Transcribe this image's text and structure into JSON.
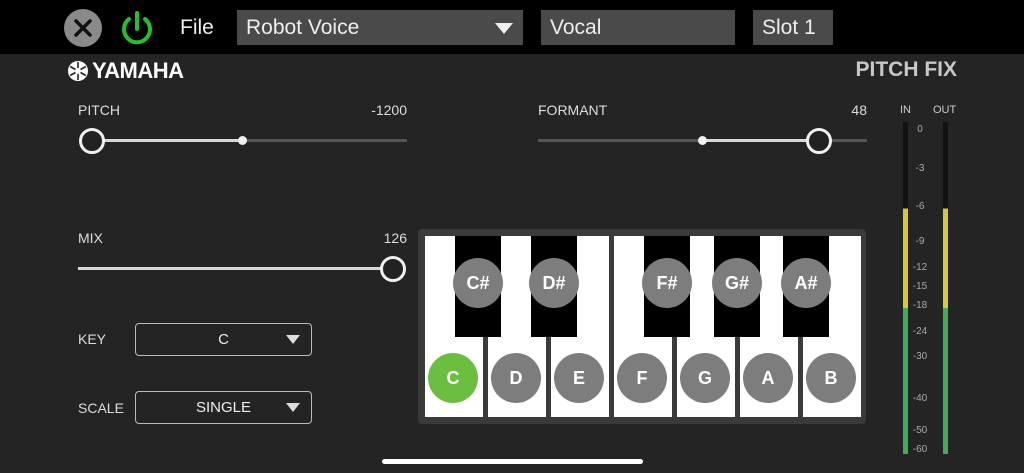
{
  "topbar": {
    "file_label": "File",
    "preset": "Robot Voice",
    "type": "Vocal",
    "slot": "Slot 1",
    "power_color": "#22c22c"
  },
  "brand": {
    "name": "YAMAHA"
  },
  "title": "PITCH FIX",
  "pitch": {
    "label": "PITCH",
    "value": "-1200",
    "level": 0.0
  },
  "formant": {
    "label": "FORMANT",
    "value": "48",
    "level": 0.87
  },
  "mix": {
    "label": "MIX",
    "value": "126",
    "level": 1.0
  },
  "key": {
    "label": "KEY",
    "selected": "C"
  },
  "scale": {
    "label": "SCALE",
    "selected": "SINGLE"
  },
  "keyboard": {
    "white_notes": [
      "C",
      "D",
      "E",
      "F",
      "G",
      "A",
      "B"
    ],
    "black_notes": [
      "C#",
      "D#",
      "F#",
      "G#",
      "A#"
    ],
    "active_note": "C",
    "active_color": "#6abf3f"
  },
  "meters": {
    "in_label": "IN",
    "out_label": "OUT",
    "scale": [
      "0",
      "-3",
      "-6",
      "-9",
      "-12",
      "-15",
      "-18",
      "-24",
      "-30",
      "-40",
      "-50",
      "-60"
    ],
    "colors": {
      "low": "#3fae5a",
      "mid": "#d8c832",
      "dark": "#111111"
    }
  }
}
